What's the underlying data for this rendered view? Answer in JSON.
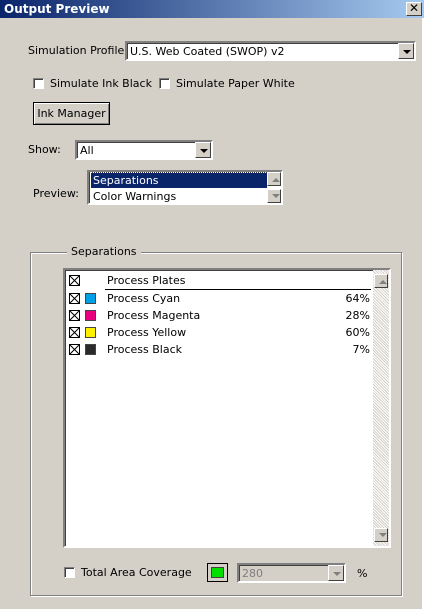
{
  "window": {
    "title": "Output Preview",
    "close_glyph": "✕"
  },
  "simulation_profile": {
    "label": "Simulation Profile:",
    "value": "U.S. Web Coated (SWOP) v2"
  },
  "checkboxes": {
    "simulate_ink_black": "Simulate Ink Black",
    "simulate_paper_white": "Simulate Paper White"
  },
  "ink_manager_button": "Ink Manager",
  "show": {
    "label": "Show:",
    "value": "All"
  },
  "preview": {
    "label": "Preview:",
    "items": [
      "Separations",
      "Color Warnings"
    ],
    "selected": "Separations"
  },
  "separations_group": {
    "title": "Separations",
    "rows": [
      {
        "name": "Process Plates",
        "percent": "",
        "color": ""
      },
      {
        "name": "Process Cyan",
        "percent": "64%",
        "color": "#00a0e8"
      },
      {
        "name": "Process Magenta",
        "percent": "28%",
        "color": "#e8007e"
      },
      {
        "name": "Process Yellow",
        "percent": "60%",
        "color": "#fff000"
      },
      {
        "name": "Process Black",
        "percent": "7%",
        "color": "#2a2a2a"
      }
    ]
  },
  "total_area_coverage": {
    "label": "Total Area Coverage",
    "swatch_color": "#00e000",
    "value": "280",
    "unit": "%"
  },
  "icons": [
    "close-icon",
    "dropdown-arrow-icon",
    "scroll-up-icon",
    "scroll-down-icon",
    "x-checkbox-icon"
  ]
}
